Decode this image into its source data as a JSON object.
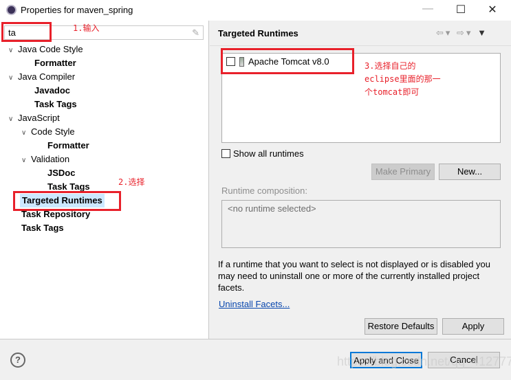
{
  "window": {
    "title": "Properties for maven_spring",
    "min": "—",
    "max": "☐",
    "close": "✕"
  },
  "filter": {
    "value": "ta"
  },
  "tree": [
    {
      "label": "Java Code Style",
      "level": 0,
      "expanded": true,
      "bold": false
    },
    {
      "label": "Formatter",
      "level": 1,
      "bold": true
    },
    {
      "label": "Java Compiler",
      "level": 0,
      "expanded": true,
      "bold": false
    },
    {
      "label": "Javadoc",
      "level": 1,
      "bold": true
    },
    {
      "label": "Task Tags",
      "level": 1,
      "bold": true
    },
    {
      "label": "JavaScript",
      "level": 0,
      "expanded": true,
      "bold": false
    },
    {
      "label": "Code Style",
      "level": 1,
      "expanded": true,
      "bold": false
    },
    {
      "label": "Formatter",
      "level": 2,
      "bold": true
    },
    {
      "label": "Validation",
      "level": 1,
      "expanded": true,
      "bold": false
    },
    {
      "label": "JSDoc",
      "level": 2,
      "bold": true
    },
    {
      "label": "Task Tags",
      "level": 2,
      "bold": true
    },
    {
      "label": "Targeted Runtimes",
      "level": 0,
      "bold": true,
      "selected": true
    },
    {
      "label": "Task Repository",
      "level": 0,
      "bold": true
    },
    {
      "label": "Task Tags",
      "level": 0,
      "bold": true
    }
  ],
  "annotations": {
    "a1": "1.输入",
    "a2": "2.选择",
    "a3": "3.选择自己的\neclipse里面的那一\n个tomcat即可"
  },
  "page": {
    "title": "Targeted Runtimes",
    "runtimes": [
      {
        "label": "Apache Tomcat v8.0",
        "checked": false
      }
    ],
    "show_all": "Show all runtimes",
    "make_primary": "Make Primary",
    "new": "New...",
    "composition_label": "Runtime composition:",
    "composition_value": "<no runtime selected>",
    "info": "If a runtime that you want to select is not displayed or is disabled you may need to uninstall one or more of the currently installed project facets.",
    "uninstall": "Uninstall Facets...",
    "restore": "Restore Defaults",
    "apply": "Apply"
  },
  "footer": {
    "apply_close": "Apply and Close",
    "cancel": "Cancel",
    "watermark": "https://blog.csdn.net/qq_41277773"
  },
  "colors": {
    "annotation": "#e8202a",
    "selection": "#cce8ff",
    "focus": "#0078d7"
  }
}
